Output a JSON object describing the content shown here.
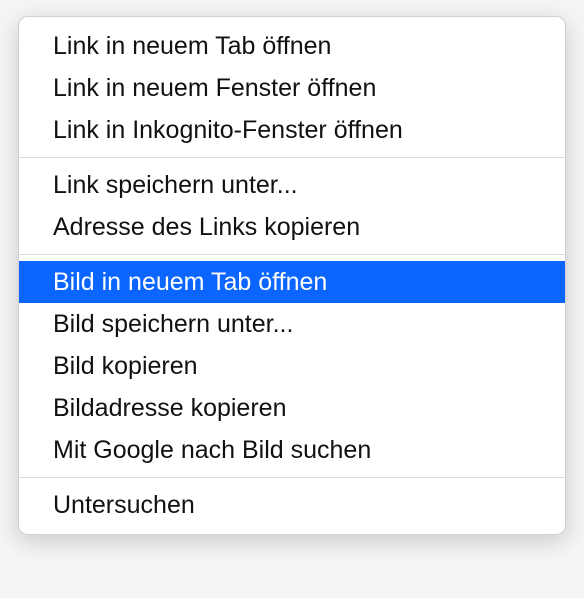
{
  "menu": {
    "groups": [
      {
        "items": [
          {
            "label": "Link in neuem Tab öffnen",
            "selected": false
          },
          {
            "label": "Link in neuem Fenster öffnen",
            "selected": false
          },
          {
            "label": "Link in Inkognito-Fenster öffnen",
            "selected": false
          }
        ]
      },
      {
        "items": [
          {
            "label": "Link speichern unter...",
            "selected": false
          },
          {
            "label": "Adresse des Links kopieren",
            "selected": false
          }
        ]
      },
      {
        "items": [
          {
            "label": "Bild in neuem Tab öffnen",
            "selected": true
          },
          {
            "label": "Bild speichern unter...",
            "selected": false
          },
          {
            "label": "Bild kopieren",
            "selected": false
          },
          {
            "label": "Bildadresse kopieren",
            "selected": false
          },
          {
            "label": "Mit Google nach Bild suchen",
            "selected": false
          }
        ]
      },
      {
        "items": [
          {
            "label": "Untersuchen",
            "selected": false
          }
        ]
      }
    ]
  }
}
